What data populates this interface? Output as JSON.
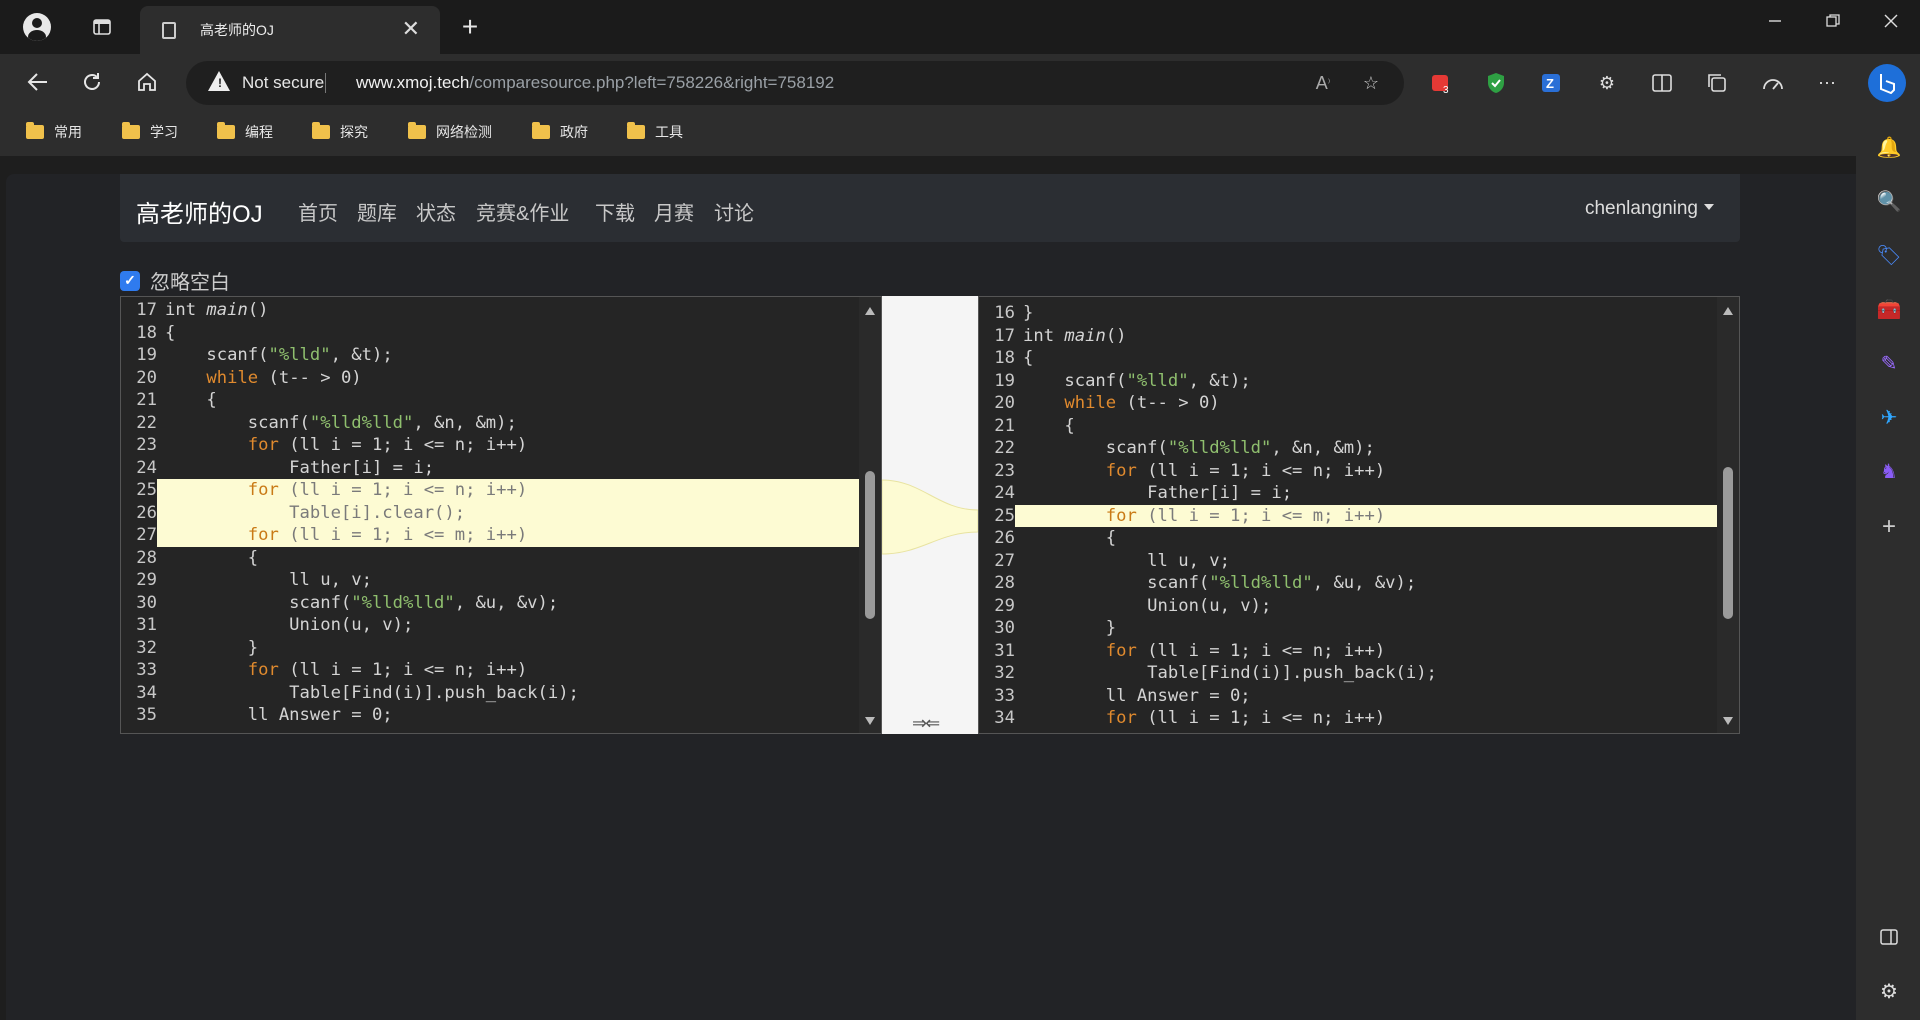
{
  "browser": {
    "tab_title": "高老师的OJ",
    "new_tab_symbol": "+",
    "tab_close_symbol": "✕",
    "address": {
      "security_label": "Not secure",
      "url_host": "www.xmoj.tech",
      "url_path": "/comparesource.php?left=758226&right=758192"
    },
    "extension_badge": "3",
    "bookmarks": [
      "常用",
      "学习",
      "编程",
      "探究",
      "网络检测",
      "政府",
      "工具"
    ]
  },
  "site": {
    "brand": "高老师的OJ",
    "nav": [
      "首页",
      "题库",
      "状态",
      "竞赛&作业",
      "下载",
      "月赛",
      "讨论"
    ],
    "user": "chenlangning",
    "ignore_whitespace_label": "忽略空白",
    "merge_arrows": "⇒⇐"
  },
  "left_lines": [
    {
      "n": "17",
      "c": "int main()"
    },
    {
      "n": "18",
      "c": "{"
    },
    {
      "n": "19",
      "c": "    scanf(\"%lld\", &t);"
    },
    {
      "n": "20",
      "c": "    while (t-- > 0)"
    },
    {
      "n": "21",
      "c": "    {"
    },
    {
      "n": "22",
      "c": "        scanf(\"%lld%lld\", &n, &m);"
    },
    {
      "n": "23",
      "c": "        for (ll i = 1; i <= n; i++)"
    },
    {
      "n": "24",
      "c": "            Father[i] = i;"
    },
    {
      "n": "25",
      "c": "        for (ll i = 1; i <= n; i++)",
      "hl": true
    },
    {
      "n": "26",
      "c": "            Table[i].clear();",
      "hl": true
    },
    {
      "n": "27",
      "c": "        for (ll i = 1; i <= m; i++)",
      "hl": true
    },
    {
      "n": "28",
      "c": "        {"
    },
    {
      "n": "29",
      "c": "            ll u, v;"
    },
    {
      "n": "30",
      "c": "            scanf(\"%lld%lld\", &u, &v);"
    },
    {
      "n": "31",
      "c": "            Union(u, v);"
    },
    {
      "n": "32",
      "c": "        }"
    },
    {
      "n": "33",
      "c": "        for (ll i = 1; i <= n; i++)"
    },
    {
      "n": "34",
      "c": "            Table[Find(i)].push_back(i);"
    },
    {
      "n": "35",
      "c": "        ll Answer = 0;"
    }
  ],
  "right_lines": [
    {
      "n": "16",
      "c": "}"
    },
    {
      "n": "17",
      "c": "int main()"
    },
    {
      "n": "18",
      "c": "{"
    },
    {
      "n": "19",
      "c": "    scanf(\"%lld\", &t);"
    },
    {
      "n": "20",
      "c": "    while (t-- > 0)"
    },
    {
      "n": "21",
      "c": "    {"
    },
    {
      "n": "22",
      "c": "        scanf(\"%lld%lld\", &n, &m);"
    },
    {
      "n": "23",
      "c": "        for (ll i = 1; i <= n; i++)"
    },
    {
      "n": "24",
      "c": "            Father[i] = i;"
    },
    {
      "n": "25",
      "c": "        for (ll i = 1; i <= m; i++)",
      "hl": true
    },
    {
      "n": "26",
      "c": "        {"
    },
    {
      "n": "27",
      "c": "            ll u, v;"
    },
    {
      "n": "28",
      "c": "            scanf(\"%lld%lld\", &u, &v);"
    },
    {
      "n": "29",
      "c": "            Union(u, v);"
    },
    {
      "n": "30",
      "c": "        }"
    },
    {
      "n": "31",
      "c": "        for (ll i = 1; i <= n; i++)"
    },
    {
      "n": "32",
      "c": "            Table[Find(i)].push_back(i);"
    },
    {
      "n": "33",
      "c": "        ll Answer = 0;"
    },
    {
      "n": "34",
      "c": "        for (ll i = 1; i <= n; i++)"
    }
  ],
  "colors": {
    "highlight": "#fdfbd3",
    "keyword": "#e08a2e",
    "string": "#8fbf6e",
    "checkbox": "#2f7bef"
  }
}
